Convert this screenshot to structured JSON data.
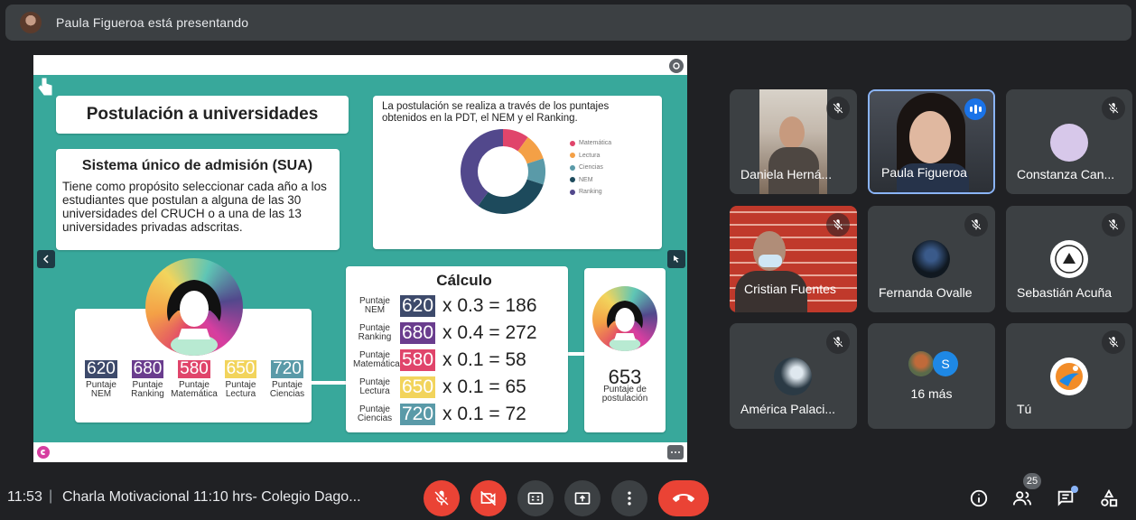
{
  "topbar": {
    "presenting_text": "Paula Figueroa está presentando"
  },
  "slide": {
    "title": "Postulación a universidades",
    "sua_title": "Sistema único de admisión (SUA)",
    "sua_text": "Tiene como propósito seleccionar cada año a los estudiantes que postulan a alguna de las 30 universidades del CRUCH o a una de las 13 universidades  privadas adscritas.",
    "chart_intro": "La postulación se realiza a través de los puntajes obtenidos en la PDT, el NEM y el Ranking.",
    "scores": [
      {
        "value": "620",
        "label": "Puntaje NEM",
        "color": "#3d4a6b"
      },
      {
        "value": "680",
        "label": "Puntaje Ranking",
        "color": "#6a3d8e"
      },
      {
        "value": "580",
        "label": "Puntaje Matemática",
        "color": "#e0456b"
      },
      {
        "value": "650",
        "label": "Puntaje Lectura",
        "color": "#f2d45c"
      },
      {
        "value": "720",
        "label": "Puntaje Ciencias",
        "color": "#5a9aa8"
      }
    ],
    "calc_title": "Cálculo",
    "calc_rows": [
      {
        "label": "Puntaje NEM",
        "value": "620",
        "op": "x 0.3 = 186",
        "color": "#3d4a6b"
      },
      {
        "label": "Puntaje Ranking",
        "value": "680",
        "op": "x 0.4 = 272",
        "color": "#6a3d8e"
      },
      {
        "label": "Puntaje Matemática",
        "value": "580",
        "op": "x 0.1 = 58",
        "color": "#e0456b"
      },
      {
        "label": "Puntaje Lectura",
        "value": "650",
        "op": "x 0.1 = 65",
        "color": "#f2d45c"
      },
      {
        "label": "Puntaje Ciencias",
        "value": "720",
        "op": "x 0.1 = 72",
        "color": "#5a9aa8"
      }
    ],
    "result_value": "653",
    "result_label": "Puntaje de postulación"
  },
  "chart_data": {
    "type": "pie",
    "categories": [
      "Matemática",
      "Lectura",
      "Ciencias",
      "NEM",
      "Ranking"
    ],
    "values": [
      10,
      10,
      10,
      30,
      40
    ],
    "colors": [
      "#e0456b",
      "#f4a046",
      "#5a9aa8",
      "#1d4a5c",
      "#52488c"
    ],
    "legend_position": "right"
  },
  "participants": [
    {
      "name": "Daniela Herná...",
      "type": "video",
      "muted": true
    },
    {
      "name": "Paula Figueroa",
      "type": "video",
      "speaking": true
    },
    {
      "name": "Constanza Can...",
      "type": "avatar",
      "muted": true
    },
    {
      "name": "Cristian Fuentes",
      "type": "video",
      "muted": true
    },
    {
      "name": "Fernanda Ovalle",
      "type": "avatar",
      "muted": true
    },
    {
      "name": "Sebastián Acuña",
      "type": "avatar",
      "muted": true
    },
    {
      "name": "América Palaci...",
      "type": "avatar",
      "muted": true
    },
    {
      "name": "16 más",
      "type": "group",
      "group_initial": "S"
    },
    {
      "name": "Tú",
      "type": "avatar",
      "muted": true
    }
  ],
  "bottombar": {
    "time": "11:53",
    "separator": "|",
    "meeting_title": "Charla Motivacional 11:10 hrs- Colegio Dago...",
    "participant_count": "25"
  },
  "colors": {
    "background": "#202124",
    "tile": "#3c4043",
    "danger": "#ea4335",
    "accent": "#8ab4f8",
    "slide_bg": "#38a89b"
  }
}
